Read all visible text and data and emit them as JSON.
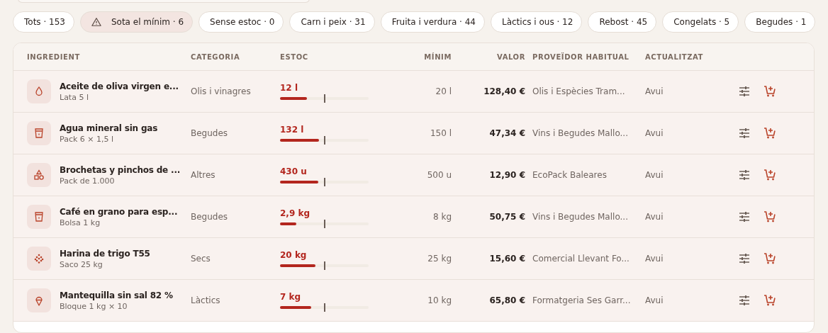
{
  "filters": [
    {
      "label": "Tots · 153",
      "selected": false,
      "kind": "plain"
    },
    {
      "label": "Sota el mínim · 6",
      "selected": true,
      "kind": "alert"
    },
    {
      "label": "Sense estoc · 0",
      "selected": false,
      "kind": "plain"
    },
    {
      "label": "Carn i peix · 31",
      "selected": false,
      "kind": "plain"
    },
    {
      "label": "Fruita i verdura · 44",
      "selected": false,
      "kind": "plain"
    },
    {
      "label": "Làctics i ous · 12",
      "selected": false,
      "kind": "plain"
    },
    {
      "label": "Rebost · 45",
      "selected": false,
      "kind": "plain"
    },
    {
      "label": "Congelats · 5",
      "selected": false,
      "kind": "plain"
    },
    {
      "label": "Begudes · 1",
      "selected": false,
      "kind": "plain"
    }
  ],
  "table": {
    "columns": [
      "INGREDIENT",
      "CATEGORIA",
      "ESTOC",
      "MÍNIM",
      "VALOR",
      "PROVEÏDOR HABITUAL",
      "ACTUALITZAT"
    ],
    "rows": [
      {
        "kind": "drop",
        "name": "Aceite de oliva virgen e...",
        "pack": "Lata 5 l",
        "category": "Olis i vinagres",
        "stock": "12 l",
        "level": 0.3,
        "minimum": "20 l",
        "value": "128,40 €",
        "supplier": "Olis i Espècies Tram...",
        "updated": "Avui"
      },
      {
        "kind": "cup",
        "name": "Agua mineral sin gas",
        "pack": "Pack 6 × 1,5 l",
        "category": "Begudes",
        "stock": "132 l",
        "level": 0.44,
        "minimum": "150 l",
        "value": "47,34 €",
        "supplier": "Vins i Begudes Mallo...",
        "updated": "Avui"
      },
      {
        "kind": "shapes",
        "name": "Brochetas y pinchos de ...",
        "pack": "Pack de 1.000",
        "category": "Altres",
        "stock": "430 u",
        "level": 0.43,
        "minimum": "500 u",
        "value": "12,90 €",
        "supplier": "EcoPack Baleares",
        "updated": "Avui"
      },
      {
        "kind": "cup",
        "name": "Café en grano para esp...",
        "pack": "Bolsa 1 kg",
        "category": "Begudes",
        "stock": "2,9 kg",
        "level": 0.18,
        "minimum": "8 kg",
        "value": "50,75 €",
        "supplier": "Vins i Begudes Mallo...",
        "updated": "Avui"
      },
      {
        "kind": "grain",
        "name": "Harina de trigo T55",
        "pack": "Saco 25 kg",
        "category": "Secs",
        "stock": "20 kg",
        "level": 0.4,
        "minimum": "25 kg",
        "value": "15,60 €",
        "supplier": "Comercial Llevant Fo...",
        "updated": "Avui"
      },
      {
        "kind": "cone",
        "name": "Mantequilla sin sal 82 %",
        "pack": "Bloque 1 kg × 10",
        "category": "Làctics",
        "stock": "7 kg",
        "level": 0.35,
        "minimum": "10 kg",
        "value": "65,80 €",
        "supplier": "Formatgeria Ses Garr...",
        "updated": "Avui"
      }
    ]
  }
}
